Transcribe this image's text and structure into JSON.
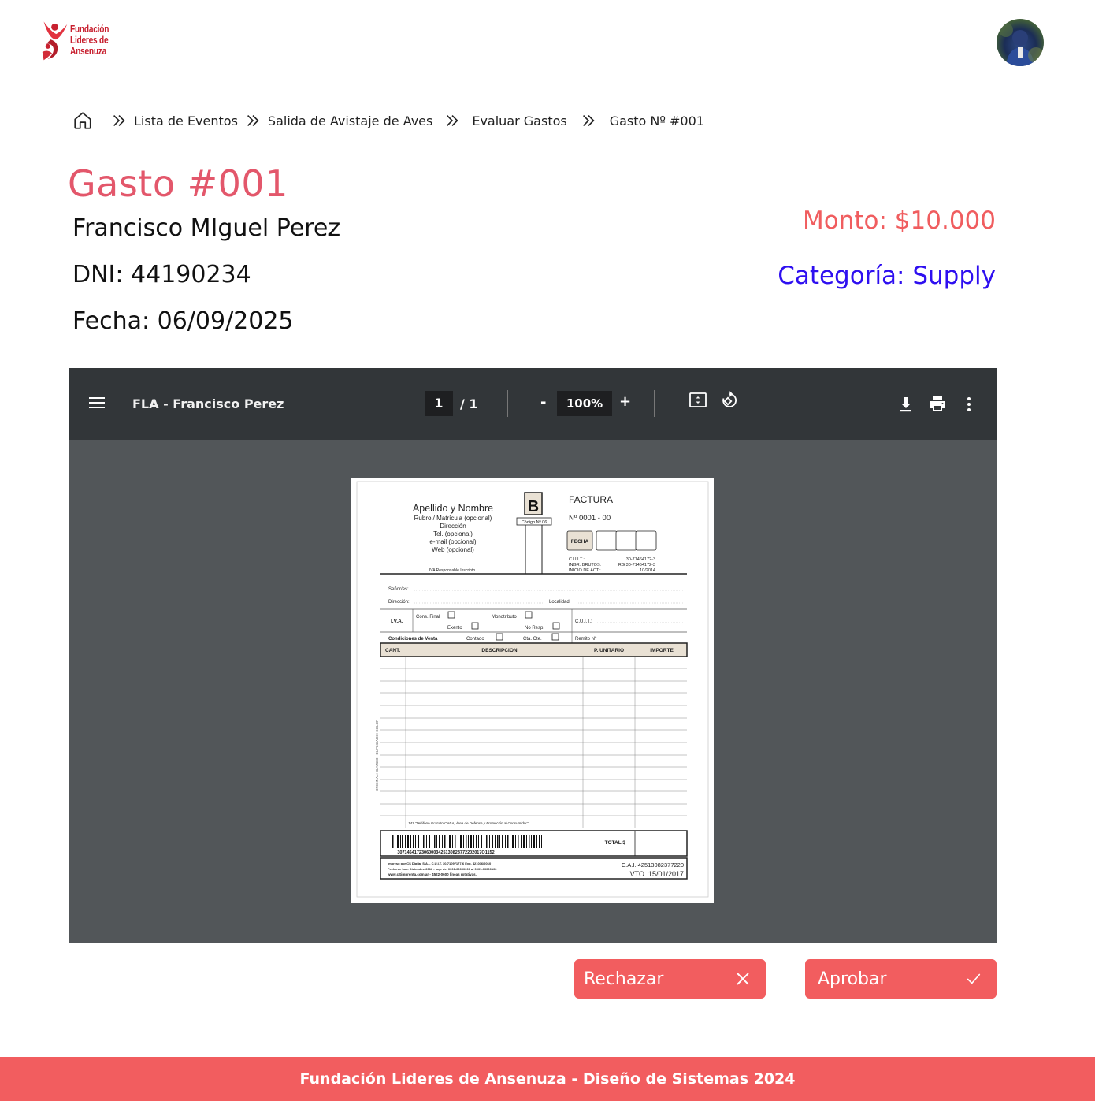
{
  "header": {
    "logo": {
      "line1": "Fundación",
      "line2": "Lideres de",
      "line3": "Ansenuza"
    }
  },
  "breadcrumb": {
    "items": [
      "Lista de Eventos",
      "Salida de Avistaje de Aves",
      "Evaluar Gastos",
      "Gasto Nº #001"
    ]
  },
  "expense": {
    "title": "Gasto #001",
    "name": "Francisco MIguel Perez",
    "dni": "DNI: 44190234",
    "date": "Fecha: 06/09/2025",
    "amount": "Monto: $10.000",
    "category": "Categoría: Supply"
  },
  "pdf_viewer": {
    "file_title": "FLA - Francisco Perez",
    "current_page": "1",
    "page_total": "/ 1",
    "zoom": "100%",
    "zoom_out": "-",
    "zoom_in": "+"
  },
  "invoice": {
    "name_label": "Apellido y Nombre",
    "rubro": "Rubro / Matrícula (opcional)",
    "direccion": "Dirección",
    "tel": "Tel. (opcional)",
    "email": "e-mail (opcional)",
    "web": "Web (opcional)",
    "iva_resp": "IVA Responsable Inscripto",
    "letter": "B",
    "codigo": "Código Nº 06",
    "factura": "FACTURA",
    "numero": "Nº 0001 - 00",
    "fecha": "FECHA",
    "cuit_label": "C.U.I.T.:",
    "cuit_value": "30-71464172-3",
    "ingr_label": "INGR. BRUTOS:",
    "ingr_value": "RG 30-71464172-3",
    "inicio_label": "INICIO DE ACT.:",
    "inicio_value": "10/2014",
    "senores": "Señor/es:",
    "direccion2": "Dirección:",
    "localidad": "Localidad:",
    "iva": "I.V.A.",
    "cons_final": "Cons. Final",
    "monotributo": "Monotributo",
    "exento": "Exento",
    "no_resp": "No Resp.",
    "cuit2": "C.U.I.T.:",
    "cond_venta": "Condiciones de Venta",
    "contado": "Contado",
    "cta_cte": "Cta. Cte.",
    "remito": "Remito Nº",
    "col_cant": "CANT.",
    "col_desc": "DESCRIPCION",
    "col_unit": "P. UNITARIO",
    "col_importe": "IMPORTE",
    "side_text": "ORIGINAL: BLANCO - DUPLICADO: COLOR",
    "phone_note": "147  \"Teléfono Gratuito CABA, Área de Defensa y Protección al Consumidor\"",
    "total": "TOTAL $",
    "barcode_num": "30714641723060003425130823772202017O1152",
    "impreso1": "Impreso por CS Digital S.A. - C.U.I.T. 30-71097177-6  Exp. 421036/2010",
    "impreso2": "Fecha de Imp. Diciembre 2016 - Imp. del 0001-00000001 al 0001-00000100",
    "impreso3": "www.cSimprenta.com.ar - 4522-0600 líneas rotativas.",
    "cai": "C.A.I. 42513082377220",
    "vto": "VTO. 15/01/2017"
  },
  "actions": {
    "reject": "Rechazar",
    "approve": "Aprobar"
  },
  "footer": {
    "text": "Fundación Lideres de Ansenuza - Diseño de Sistemas 2024"
  },
  "colors": {
    "accent": "#f25d5f",
    "title_pink": "#e3576b",
    "category_blue": "#2e0ff0",
    "viewer_bg": "#525659",
    "toolbar_bg": "#323639"
  },
  "icons": [
    "home-icon",
    "double-chevron-right-icon",
    "hamburger-menu-icon",
    "fit-page-icon",
    "rotate-icon",
    "download-icon",
    "print-icon",
    "more-vertical-icon",
    "close-icon",
    "check-icon"
  ]
}
